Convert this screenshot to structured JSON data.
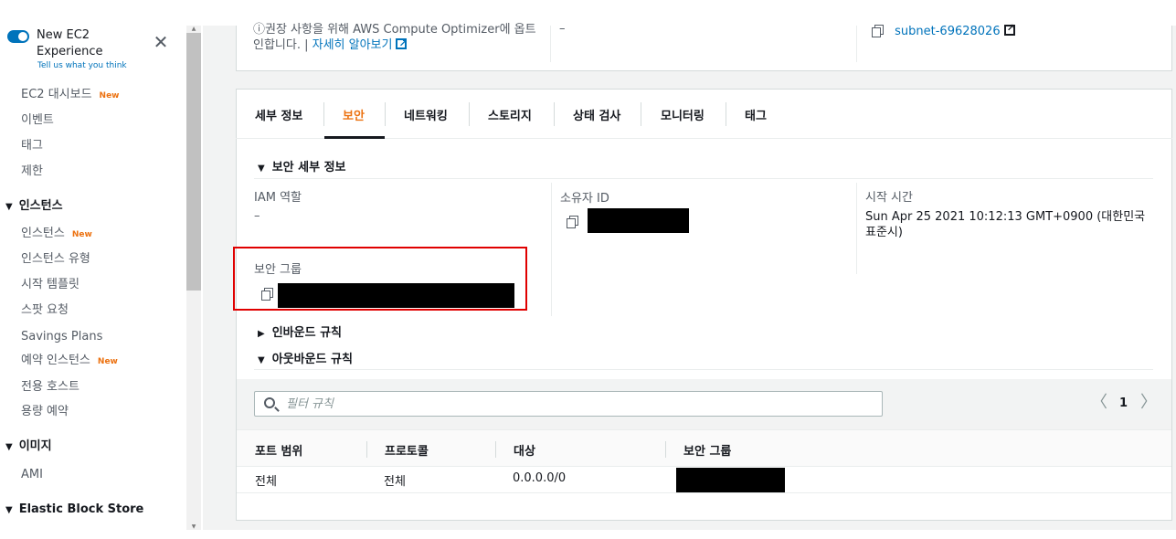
{
  "sidebar": {
    "experience_title": "New EC2 Experience",
    "experience_sub": "Tell us what you think",
    "close_glyph": "✕",
    "new_badge": "New",
    "items_top": [
      {
        "label": "EC2 대시보드",
        "new": true
      },
      {
        "label": "이벤트",
        "new": false
      },
      {
        "label": "태그",
        "new": false
      },
      {
        "label": "제한",
        "new": false
      }
    ],
    "section_instances": "인스턴스",
    "instances_items": [
      {
        "label": "인스턴스",
        "new": true
      },
      {
        "label": "인스턴스 유형",
        "new": false
      },
      {
        "label": "시작 템플릿",
        "new": false
      },
      {
        "label": "스팟 요청",
        "new": false
      },
      {
        "label": "Savings Plans",
        "new": false
      },
      {
        "label": "예약 인스턴스",
        "new": true
      },
      {
        "label": "전용 호스트",
        "new": false
      },
      {
        "label": "용량 예약",
        "new": false
      }
    ],
    "section_images": "이미지",
    "images_items": [
      {
        "label": "AMI",
        "new": false
      }
    ],
    "section_ebs": "Elastic Block Store"
  },
  "top_panel": {
    "note_line1": "ⓘ권장 사항을 위해 AWS Compute Optimizer에 옵트",
    "note_line2": "인합니다. | ",
    "learn_more": "자세히 알아보기",
    "dash": "–",
    "subnet": "subnet-69628026"
  },
  "tabs": [
    {
      "label": "세부 정보",
      "active": false
    },
    {
      "label": "보안",
      "active": true
    },
    {
      "label": "네트워킹",
      "active": false
    },
    {
      "label": "스토리지",
      "active": false
    },
    {
      "label": "상태 검사",
      "active": false
    },
    {
      "label": "모니터링",
      "active": false
    },
    {
      "label": "태그",
      "active": false
    }
  ],
  "security": {
    "section_title": "보안 세부 정보",
    "iam_label": "IAM 역할",
    "iam_value": "–",
    "owner_label": "소유자 ID",
    "launch_label": "시작 시간",
    "launch_value": "Sun Apr 25 2021 10:12:13 GMT+0900 (대한민국 표준시)",
    "sg_label": "보안 그룹",
    "inbound": "인바운드 규칙",
    "outbound": "아웃바운드 규칙"
  },
  "filter": {
    "placeholder": "필터 규칙",
    "page": "1",
    "prev": "〈",
    "next": "〉"
  },
  "table": {
    "headers": [
      "포트 범위",
      "프로토콜",
      "대상",
      "보안 그룹"
    ],
    "rows": [
      {
        "port": "전체",
        "protocol": "전체",
        "destination": "0.0.0.0/0"
      }
    ]
  },
  "colors": {
    "accent": "#ec7211",
    "link": "#0073bb",
    "highlight_box": "#e00000"
  }
}
